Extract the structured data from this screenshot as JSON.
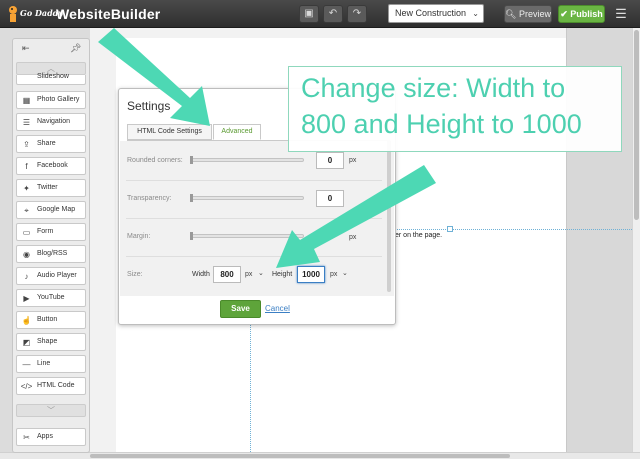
{
  "topbar": {
    "logo_text": "Go Daddy",
    "brand": "WebsiteBuilder",
    "page_select": "New Construction",
    "preview_label": "Preview",
    "publish_label": "Publish"
  },
  "left_panel": {
    "partial_item": "Slideshow",
    "items": [
      {
        "label": "Photo Gallery",
        "icon": "photo-gallery-icon"
      },
      {
        "label": "Navigation",
        "icon": "navigation-icon"
      },
      {
        "label": "Share",
        "icon": "share-icon"
      },
      {
        "label": "Facebook",
        "icon": "facebook-icon"
      },
      {
        "label": "Twitter",
        "icon": "twitter-icon"
      },
      {
        "label": "Google Map",
        "icon": "google-map-icon"
      },
      {
        "label": "Form",
        "icon": "form-icon"
      },
      {
        "label": "Blog/RSS",
        "icon": "blog-rss-icon"
      },
      {
        "label": "Audio Player",
        "icon": "audio-player-icon"
      },
      {
        "label": "YouTube",
        "icon": "youtube-icon"
      },
      {
        "label": "Button",
        "icon": "button-icon"
      },
      {
        "label": "Shape",
        "icon": "shape-icon"
      },
      {
        "label": "Line",
        "icon": "line-icon"
      },
      {
        "label": "HTML Code",
        "icon": "html-code-icon"
      }
    ],
    "apps_label": "Apps"
  },
  "page": {
    "hint_text": "render on the page."
  },
  "dialog": {
    "title": "Settings",
    "tabs": [
      "HTML Code Settings",
      "Advanced"
    ],
    "active_tab": "Advanced",
    "rounded_label": "Rounded corners:",
    "rounded_value": "0",
    "transparency_label": "Transparency:",
    "transparency_value": "0",
    "margin_label": "Margin:",
    "unit": "px",
    "size_label": "Size:",
    "width_label": "Width",
    "width_value": "800",
    "height_label": "Height",
    "height_value": "1000",
    "save_label": "Save",
    "cancel_label": "Cancel"
  },
  "callout": {
    "line1": "Change size: Width to",
    "line2": "800 and Height to 1000",
    "color": "#4dd0b0"
  }
}
